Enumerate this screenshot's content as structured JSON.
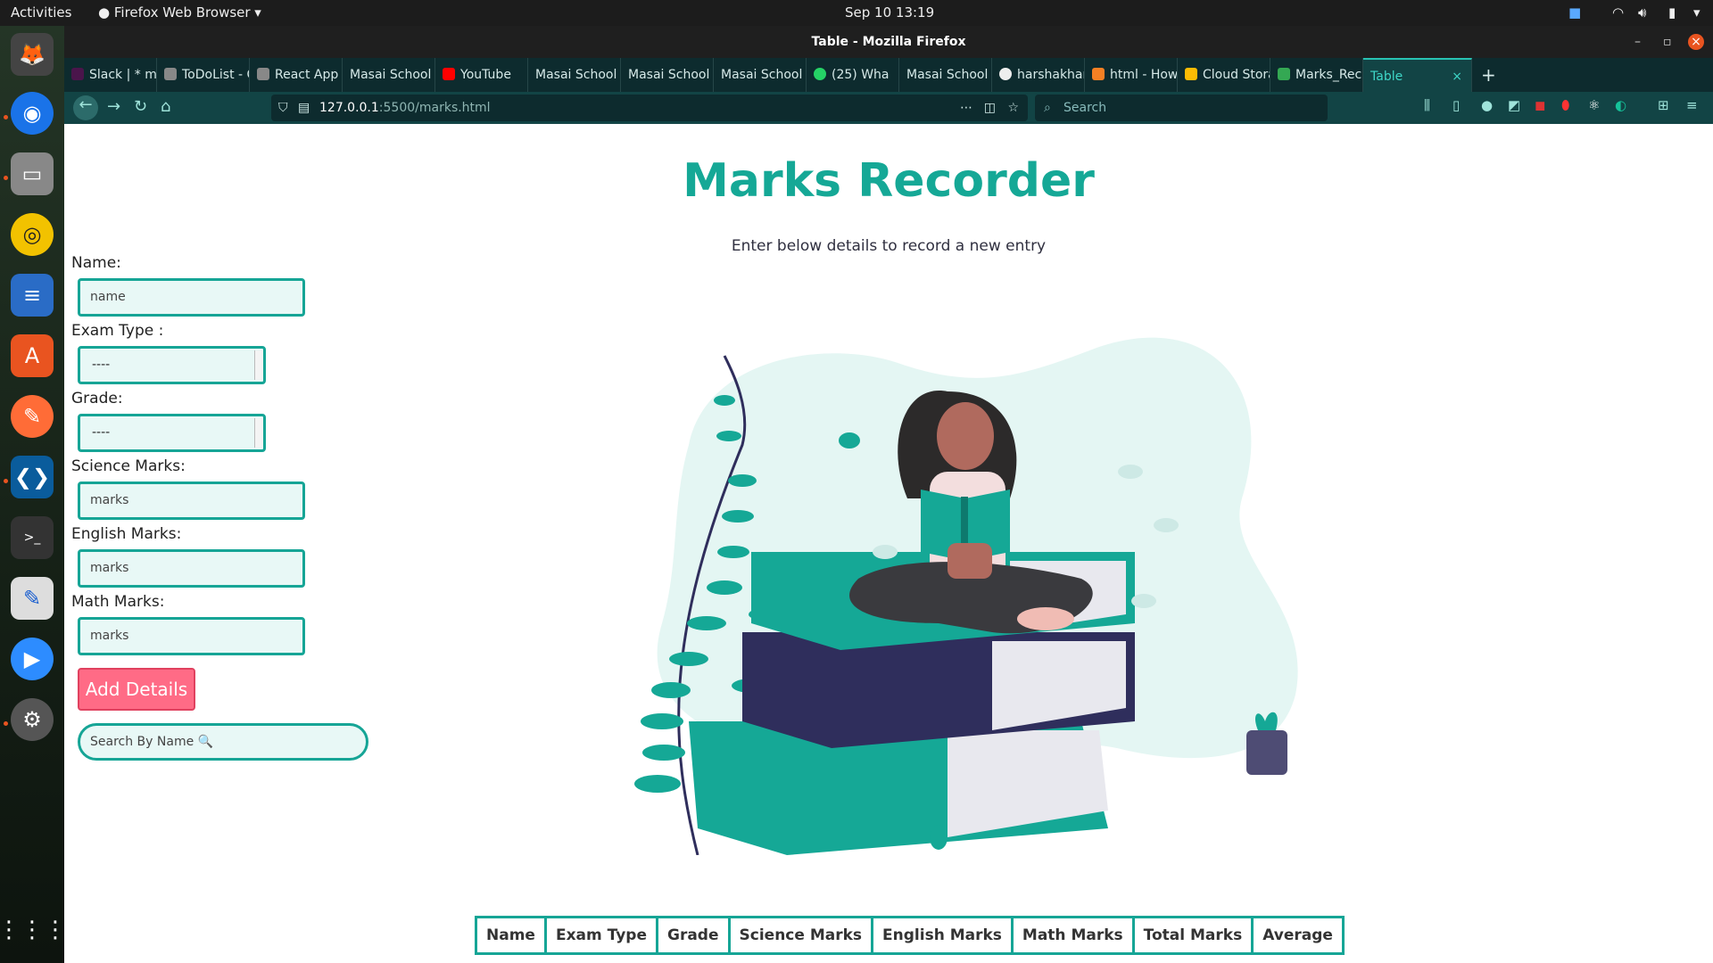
{
  "topbar": {
    "activities": "Activities",
    "app": "Firefox Web Browser ▾",
    "clock": "Sep 10  13:19"
  },
  "window": {
    "title": "Table - Mozilla Firefox"
  },
  "tabs": [
    {
      "label": "Slack | * mo",
      "color": "#4a154b"
    },
    {
      "label": "ToDoList - C",
      "color": "#888"
    },
    {
      "label": "React App",
      "color": "#888"
    },
    {
      "label": "Masai School",
      "color": "#124445"
    },
    {
      "label": "YouTube",
      "color": "#ff0000"
    },
    {
      "label": "Masai School",
      "color": "#124445"
    },
    {
      "label": "Masai School",
      "color": "#124445"
    },
    {
      "label": "Masai School",
      "color": "#124445"
    },
    {
      "label": "(25) Wha",
      "color": "#25d366"
    },
    {
      "label": "Masai School",
      "color": "#124445"
    },
    {
      "label": "harshakhan",
      "color": "#222"
    },
    {
      "label": "html - How",
      "color": "#f48024"
    },
    {
      "label": "Cloud Stora",
      "color": "#fbbc04"
    },
    {
      "label": "Marks_Reco",
      "color": "#34a853"
    },
    {
      "label": "Table",
      "color": "#124445"
    }
  ],
  "nav": {
    "url_host": "127.0.0.1",
    "url_rest": ":5500/marks.html",
    "search_placeholder": "Search"
  },
  "page": {
    "title": "Marks Recorder",
    "subtitle": "Enter below details to record a new entry",
    "form": {
      "name_label": "Name:",
      "name_placeholder": "name",
      "exam_label": "Exam Type :",
      "exam_value": "----",
      "grade_label": "Grade:",
      "grade_value": "----",
      "science_label": "Science Marks:",
      "science_placeholder": "marks",
      "english_label": "English Marks:",
      "english_placeholder": "marks",
      "math_label": "Math Marks:",
      "math_placeholder": "marks",
      "add_button": "Add Details",
      "search_placeholder": "Search By Name 🔍"
    },
    "table": {
      "headers": [
        "Name",
        "Exam Type",
        "Grade",
        "Science Marks",
        "English Marks",
        "Math Marks",
        "Total Marks",
        "Average"
      ]
    }
  },
  "colors": {
    "accent": "#15a896",
    "button": "#ff6b86",
    "navy": "#2f2e5c"
  }
}
